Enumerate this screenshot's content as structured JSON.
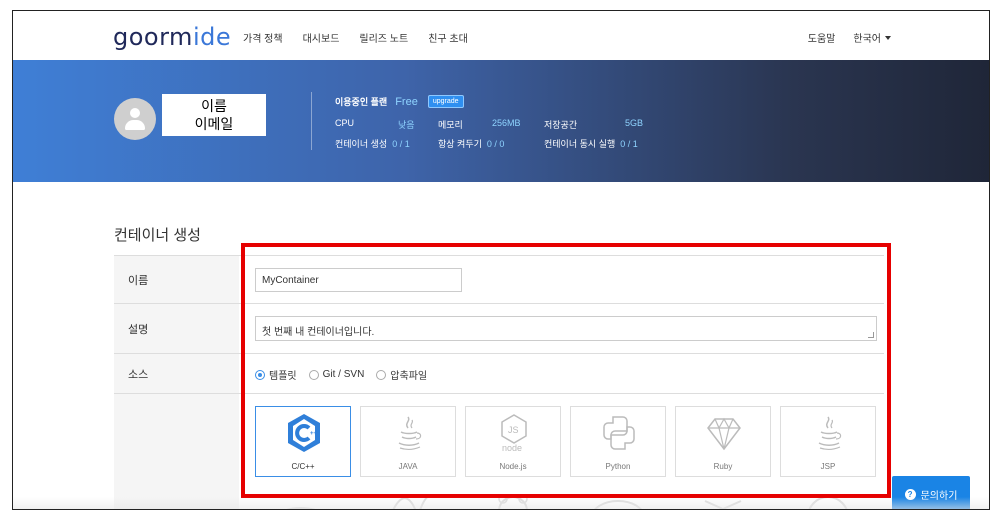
{
  "brand": {
    "logo_main": "goorm",
    "logo_accent": "ide"
  },
  "nav": {
    "links": [
      "가격 정책",
      "대시보드",
      "릴리즈 노트",
      "친구 초대"
    ],
    "help": "도움말",
    "language": "한국어"
  },
  "profile": {
    "name": "이름",
    "email": "이메일"
  },
  "plan": {
    "label": "이용중인 플랜",
    "value": "Free",
    "upgrade": "upgrade",
    "cpu_label": "CPU",
    "cpu_value": "낮음",
    "memory_label": "메모리",
    "memory_value": "256MB",
    "storage_label": "저장공간",
    "storage_value": "5GB",
    "create_label": "컨테이너 생성",
    "create_value": "0 / 1",
    "always_on_label": "항상 켜두기",
    "always_on_value": "0 / 0",
    "concurrent_label": "컨테이너 동시 실행",
    "concurrent_value": "0 / 1"
  },
  "section": {
    "title": "컨테이너 생성"
  },
  "form": {
    "name_label": "이름",
    "name_value": "MyContainer",
    "desc_label": "설명",
    "desc_value": "첫 번째 내 컨테이너입니다.",
    "source_label": "소스",
    "source_options": [
      "템플릿",
      "Git / SVN",
      "압축파일"
    ],
    "source_selected": "템플릿"
  },
  "templates": [
    "C/C++",
    "JAVA",
    "Node.js",
    "Python",
    "Ruby",
    "JSP"
  ],
  "inquiry": {
    "label": "문의하기"
  },
  "colors": {
    "accent": "#3a8ee6",
    "highlight": "#e60000",
    "brand": "#20295a"
  }
}
